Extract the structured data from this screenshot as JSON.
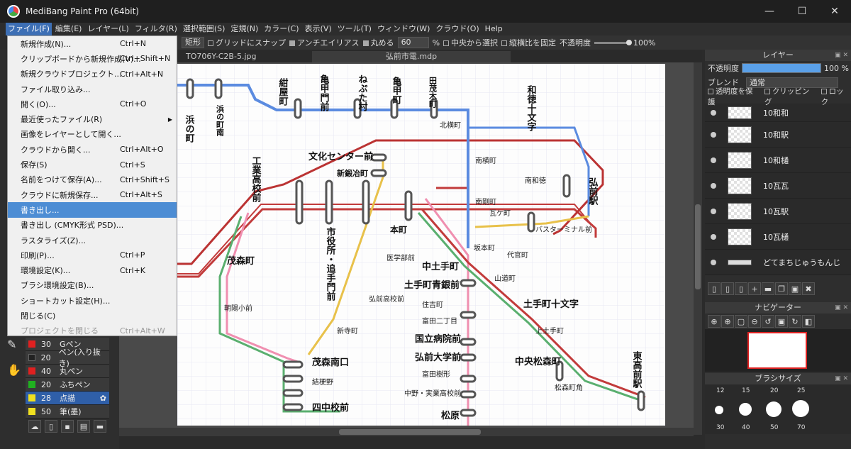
{
  "window": {
    "title": "MediBang Paint Pro (64bit)",
    "min": "—",
    "max": "☐",
    "close": "✕"
  },
  "menubar": [
    "ファイル(F)",
    "編集(E)",
    "レイヤー(L)",
    "フィルタ(R)",
    "選択範囲(S)",
    "定規(N)",
    "カラー(C)",
    "表示(V)",
    "ツール(T)",
    "ウィンドウ(W)",
    "クラウド(O)",
    "Help"
  ],
  "toolbar": {
    "mode": "矩形",
    "snap": "グリッドにスナップ",
    "antialias": "アンチエイリアス",
    "round": "丸める",
    "round_value": "60",
    "percent": "%",
    "from_center": "中央から選択",
    "fix_ratio": "縦横比を固定",
    "opacity": "不透明度",
    "opacity_value": "100%"
  },
  "tabs": {
    "tab1": "TO706Y-C2B-5.jpg",
    "tab2": "弘前市電.mdp"
  },
  "file_menu": [
    {
      "label": "新規作成(N)...",
      "shortcut": "Ctrl+N"
    },
    {
      "label": "クリップボードから新規作成(V)...",
      "shortcut": "Ctrl+Shift+N"
    },
    {
      "label": "新規クラウドプロジェクト...",
      "shortcut": "Ctrl+Alt+N"
    },
    {
      "label": "ファイル取り込み...",
      "shortcut": ""
    },
    {
      "label": "開く(O)...",
      "shortcut": "Ctrl+O"
    },
    {
      "label": "最近使ったファイル(R)",
      "shortcut": ""
    },
    {
      "label": "画像をレイヤーとして開く...",
      "shortcut": ""
    },
    {
      "label": "クラウドから開く...",
      "shortcut": "Ctrl+Alt+O"
    },
    {
      "label": "保存(S)",
      "shortcut": "Ctrl+S"
    },
    {
      "label": "名前をつけて保存(A)...",
      "shortcut": "Ctrl+Shift+S"
    },
    {
      "label": "クラウドに新規保存...",
      "shortcut": "Ctrl+Alt+S"
    },
    {
      "label": "書き出し...",
      "shortcut": ""
    },
    {
      "label": "書き出し (CMYK形式 PSD)...",
      "shortcut": ""
    },
    {
      "label": "ラスタライズ(Z)...",
      "shortcut": ""
    },
    {
      "label": "印刷(P)...",
      "shortcut": "Ctrl+P"
    },
    {
      "label": "環境設定(K)...",
      "shortcut": "Ctrl+K"
    },
    {
      "label": "ブラシ環境設定(B)...",
      "shortcut": ""
    },
    {
      "label": "ショートカット設定(H)...",
      "shortcut": ""
    },
    {
      "label": "閉じる(C)",
      "shortcut": ""
    },
    {
      "label": "プロジェクトを閉じる",
      "shortcut": "Ctrl+Alt+W"
    }
  ],
  "brushes": [
    {
      "size": "30",
      "name": "Gペン",
      "color": "#e02020"
    },
    {
      "size": "20",
      "name": "ペン(入り抜き)",
      "color": "#222222"
    },
    {
      "size": "40",
      "name": "丸ペン",
      "color": "#e02020"
    },
    {
      "size": "20",
      "name": "ふちペン",
      "color": "#20b020"
    },
    {
      "size": "28",
      "name": "点描",
      "color": "#f0e020"
    },
    {
      "size": "50",
      "name": "筆(墨)",
      "color": "#f0e020"
    }
  ],
  "layer_panel": {
    "title": "レイヤー",
    "opacity_label": "不透明度",
    "opacity_value": "100 %",
    "blend_label": "ブレンド",
    "blend_value": "通常",
    "protect": "透明度を保護",
    "clipping": "クリッピング",
    "lock": "ロック",
    "layers": [
      "10和和",
      "10和駅",
      "10和樋",
      "10瓦瓦",
      "10瓦駅",
      "10瓦樋",
      "どてまちじゅうもんじ"
    ]
  },
  "navigator": {
    "title": "ナビゲーター"
  },
  "brush_size": {
    "title": "ブラシサイズ",
    "row1": [
      "12",
      "15",
      "20",
      "25"
    ],
    "row2": [
      "30",
      "40",
      "50",
      "70"
    ]
  },
  "map": {
    "stations": [
      "浜の町",
      "浜の町南",
      "紺屋町",
      "富士見橋",
      "亀甲門前",
      "ねぷた村",
      "亀甲町",
      "田茂木町",
      "和徳十文字",
      "北横町",
      "菅町",
      "文化センター前",
      "新鍛冶町",
      "笹森町",
      "下土手町",
      "南横町",
      "南和徳",
      "弘前駅",
      "工業高校前",
      "鷹匠町",
      "二中校入口",
      "城西三丁目",
      "城西局前",
      "茜町",
      "東奥日報前",
      "市役所・追手門前",
      "元長町",
      "本町",
      "南剛町",
      "中三前",
      "瓦ケ町",
      "バスターミナル前",
      "坂本町",
      "代官町",
      "茂森町",
      "医学部前",
      "中土手町",
      "山道町",
      "土手町青銀前",
      "朝陽小前",
      "弘前高校前",
      "住吉町",
      "土手町十文字",
      "富田二丁目",
      "新寺町",
      "上土手町",
      "国立病院前",
      "弘前大学前",
      "中央松森町",
      "茂森南口",
      "富田樹形",
      "東高前駅",
      "結梗野",
      "中野・実業高校前",
      "松森町角",
      "南大町",
      "四中校前",
      "松原"
    ]
  }
}
